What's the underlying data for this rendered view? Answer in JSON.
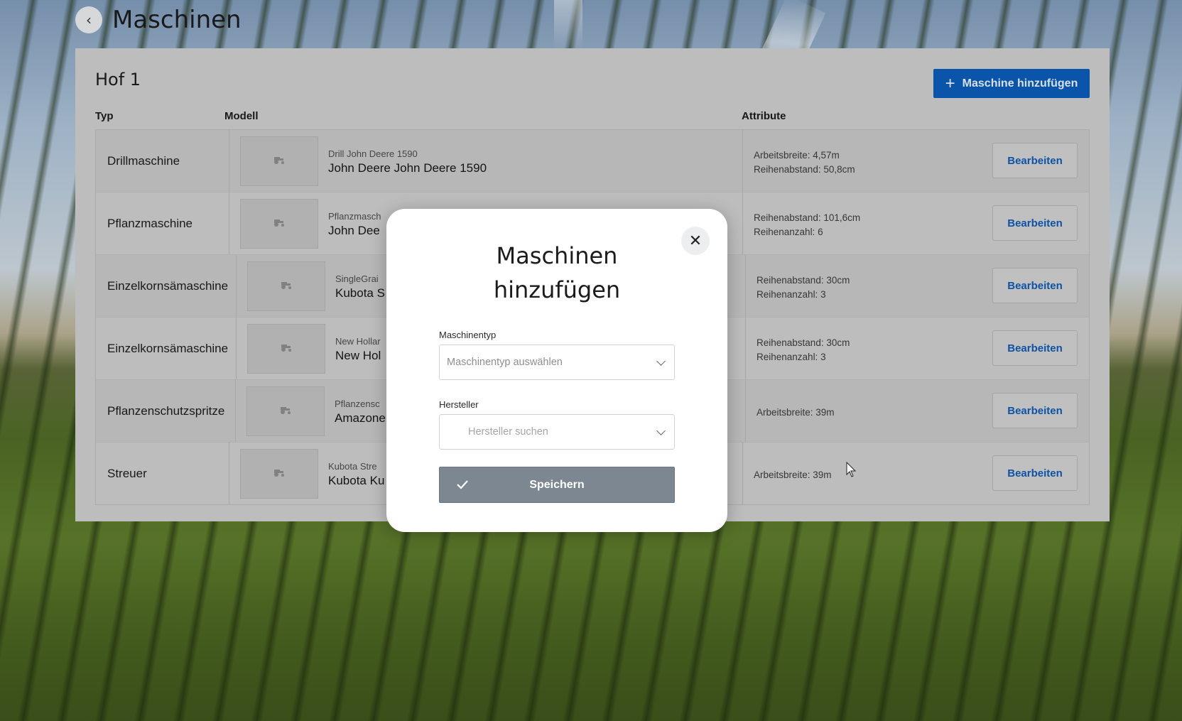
{
  "page": {
    "title": "Maschinen",
    "back_icon": "chevron-left-icon"
  },
  "card": {
    "title": "Hof 1",
    "add_button_label": "Maschine hinzufügen",
    "add_icon": "plus-icon",
    "columns": {
      "typ": "Typ",
      "modell": "Modell",
      "attribute": "Attribute"
    },
    "rows": [
      {
        "typ": "Drillmaschine",
        "model_sub": "Drill John Deere 1590",
        "model_main": "John Deere John Deere 1590",
        "attr1": "Arbeitsbreite: 4,57m",
        "attr2": "Reihenabstand: 50,8cm",
        "edit": "Bearbeiten"
      },
      {
        "typ": "Pflanzmaschine",
        "model_sub": "Pflanzmasch",
        "model_main": "John Dee",
        "attr1": "Reihenabstand: 101,6cm",
        "attr2": "Reihenanzahl: 6",
        "edit": "Bearbeiten"
      },
      {
        "typ": "Einzelkornsämaschine",
        "model_sub": "SingleGrai",
        "model_main": "Kubota S",
        "attr1": "Reihenabstand: 30cm",
        "attr2": "Reihenanzahl: 3",
        "edit": "Bearbeiten"
      },
      {
        "typ": "Einzelkornsämaschine",
        "model_sub": "New Hollar",
        "model_main": "New Hol",
        "attr1": "Reihenabstand: 30cm",
        "attr2": "Reihenanzahl: 3",
        "edit": "Bearbeiten"
      },
      {
        "typ": "Pflanzenschutzspritze",
        "model_sub": "Pflanzensc",
        "model_main": "Amazone",
        "attr1": "Arbeitsbreite: 39m",
        "attr2": "",
        "edit": "Bearbeiten"
      },
      {
        "typ": "Streuer",
        "model_sub": "Kubota Stre",
        "model_main": "Kubota Ku",
        "attr1": "Arbeitsbreite: 39m",
        "attr2": "",
        "edit": "Bearbeiten"
      }
    ]
  },
  "modal": {
    "title": "Maschinen hinzufügen",
    "close_icon": "close-icon",
    "machine_type_label": "Maschinentyp",
    "machine_type_placeholder": "Maschinentyp auswählen",
    "manufacturer_label": "Hersteller",
    "manufacturer_placeholder": "Hersteller suchen",
    "save_label": "Speichern",
    "save_icon": "check-icon"
  },
  "colors": {
    "primary": "#0b5bb5",
    "save_disabled": "#7c8791",
    "link": "#0d58b0"
  }
}
